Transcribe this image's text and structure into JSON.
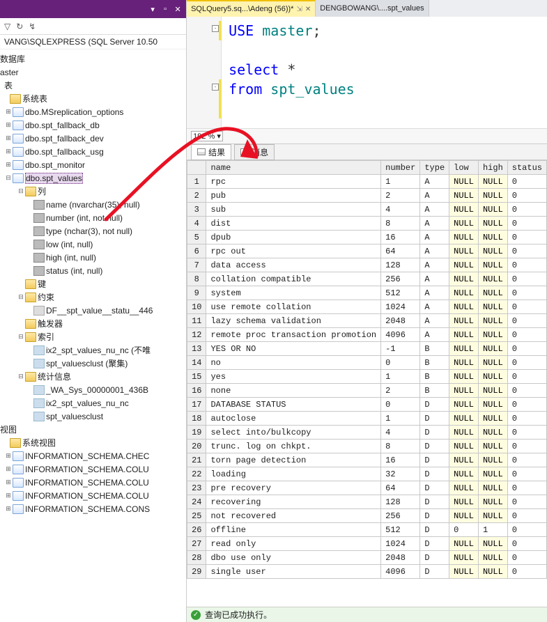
{
  "left": {
    "title_icons": {
      "dropdown": "▾",
      "pin": "📌",
      "close": "✕"
    },
    "tool_funnel": "▿",
    "tool_refresh": "↻",
    "tool_link": "⇆",
    "connection": "VANG\\SQLEXPRESS (SQL Server 10.50",
    "nodes": {
      "db": "数据库",
      "master": "aster",
      "tables": "表",
      "systables": "系统表",
      "t_msrep": "dbo.MSreplication_options",
      "t_fbdb": "dbo.spt_fallback_db",
      "t_fbdev": "dbo.spt_fallback_dev",
      "t_fbusg": "dbo.spt_fallback_usg",
      "t_mon": "dbo.spt_monitor",
      "t_val": "dbo.spt_values",
      "cols": "列",
      "c_name": "name (nvarchar(35), null)",
      "c_number": "number (int, not null)",
      "c_type": "type (nchar(3), not null)",
      "c_low": "low (int, null)",
      "c_high": "high (int, null)",
      "c_status": "status (int, null)",
      "keys": "键",
      "constraints": "约束",
      "df": "DF__spt_value__statu__446",
      "triggers": "触发器",
      "indexes": "索引",
      "ix2": "ix2_spt_values_nu_nc (不唯",
      "ixclust": "spt_valuesclust (聚集)",
      "stats": "统计信息",
      "wa": "_WA_Sys_00000001_436B",
      "ix2s": "ix2_spt_values_nu_nc",
      "clusts": "spt_valuesclust",
      "views": "视图",
      "sysviews": "系统视图",
      "v1": "INFORMATION_SCHEMA.CHEC",
      "v2": "INFORMATION_SCHEMA.COLU",
      "v3": "INFORMATION_SCHEMA.COLU",
      "v4": "INFORMATION_SCHEMA.COLU",
      "v5": "INFORMATION_SCHEMA.CONS"
    }
  },
  "tabs": {
    "active": "SQLQuery5.sq...\\Adeng (56))*",
    "pinned_icon": "⇱",
    "close_icon": "✕",
    "other": "DENGBOWANG\\....spt_values"
  },
  "code": {
    "l1_kw": "USE",
    "l1_nm": "master",
    "l1_end": ";",
    "l3_kw": "select",
    "l3_star": " *",
    "l4_kw": "from",
    "l4_nm": "spt_values"
  },
  "zoom": "192 %",
  "resulttabs": {
    "results": "结果",
    "messages": "消息"
  },
  "cols": [
    "",
    "name",
    "number",
    "type",
    "low",
    "high",
    "status"
  ],
  "rows": [
    [
      "1",
      "rpc",
      "1",
      "A",
      "NULL",
      "NULL",
      "0"
    ],
    [
      "2",
      "pub",
      "2",
      "A",
      "NULL",
      "NULL",
      "0"
    ],
    [
      "3",
      "sub",
      "4",
      "A",
      "NULL",
      "NULL",
      "0"
    ],
    [
      "4",
      "dist",
      "8",
      "A",
      "NULL",
      "NULL",
      "0"
    ],
    [
      "5",
      "dpub",
      "16",
      "A",
      "NULL",
      "NULL",
      "0"
    ],
    [
      "6",
      "rpc out",
      "64",
      "A",
      "NULL",
      "NULL",
      "0"
    ],
    [
      "7",
      "data access",
      "128",
      "A",
      "NULL",
      "NULL",
      "0"
    ],
    [
      "8",
      "collation compatible",
      "256",
      "A",
      "NULL",
      "NULL",
      "0"
    ],
    [
      "9",
      "system",
      "512",
      "A",
      "NULL",
      "NULL",
      "0"
    ],
    [
      "10",
      "use remote collation",
      "1024",
      "A",
      "NULL",
      "NULL",
      "0"
    ],
    [
      "11",
      "lazy schema validation",
      "2048",
      "A",
      "NULL",
      "NULL",
      "0"
    ],
    [
      "12",
      "remote proc transaction promotion",
      "4096",
      "A",
      "NULL",
      "NULL",
      "0"
    ],
    [
      "13",
      "YES OR NO",
      "-1",
      "B",
      "NULL",
      "NULL",
      "0"
    ],
    [
      "14",
      "no",
      "0",
      "B",
      "NULL",
      "NULL",
      "0"
    ],
    [
      "15",
      "yes",
      "1",
      "B",
      "NULL",
      "NULL",
      "0"
    ],
    [
      "16",
      "none",
      "2",
      "B",
      "NULL",
      "NULL",
      "0"
    ],
    [
      "17",
      "DATABASE STATUS",
      "0",
      "D",
      "NULL",
      "NULL",
      "0"
    ],
    [
      "18",
      "autoclose",
      "1",
      "D",
      "NULL",
      "NULL",
      "0"
    ],
    [
      "19",
      "select into/bulkcopy",
      "4",
      "D",
      "NULL",
      "NULL",
      "0"
    ],
    [
      "20",
      "trunc. log on chkpt.",
      "8",
      "D",
      "NULL",
      "NULL",
      "0"
    ],
    [
      "21",
      "torn page detection",
      "16",
      "D",
      "NULL",
      "NULL",
      "0"
    ],
    [
      "22",
      "loading",
      "32",
      "D",
      "NULL",
      "NULL",
      "0"
    ],
    [
      "23",
      "pre recovery",
      "64",
      "D",
      "NULL",
      "NULL",
      "0"
    ],
    [
      "24",
      "recovering",
      "128",
      "D",
      "NULL",
      "NULL",
      "0"
    ],
    [
      "25",
      "not recovered",
      "256",
      "D",
      "NULL",
      "NULL",
      "0"
    ],
    [
      "26",
      "offline",
      "512",
      "D",
      "0",
      "1",
      "0"
    ],
    [
      "27",
      "read only",
      "1024",
      "D",
      "NULL",
      "NULL",
      "0"
    ],
    [
      "28",
      "dbo use only",
      "2048",
      "D",
      "NULL",
      "NULL",
      "0"
    ],
    [
      "29",
      "single user",
      "4096",
      "D",
      "NULL",
      "NULL",
      "0"
    ]
  ],
  "status": {
    "ok": "✓",
    "text": "查询已成功执行。"
  }
}
